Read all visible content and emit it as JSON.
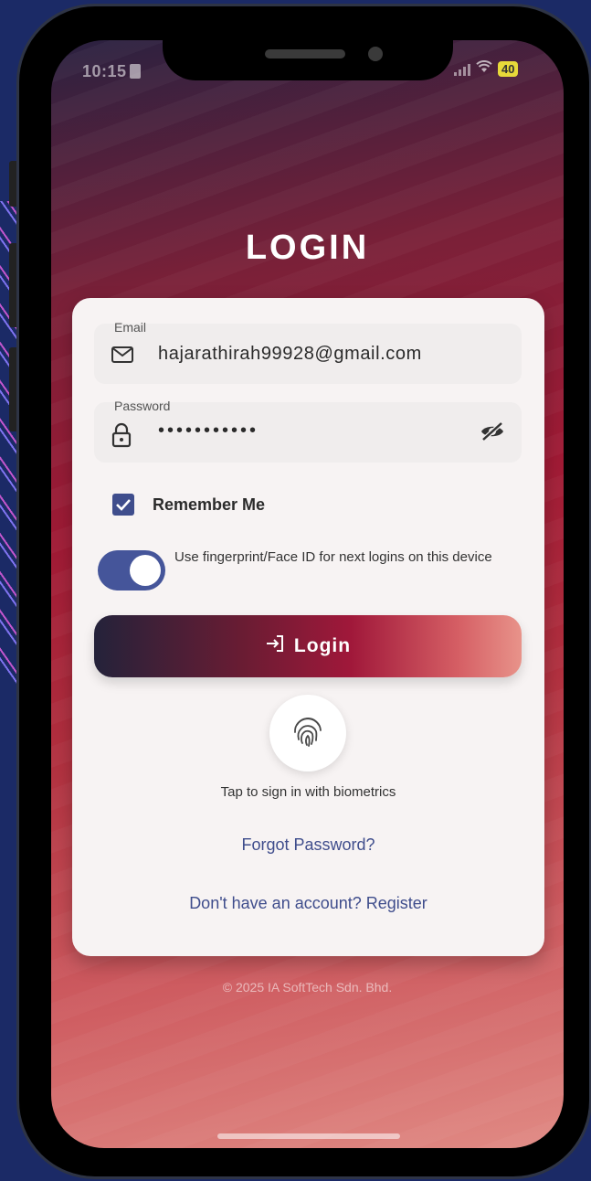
{
  "status_bar": {
    "time": "10:15",
    "battery": "40"
  },
  "page": {
    "title": "LOGIN"
  },
  "form": {
    "email_label": "Email",
    "email_value": "hajarathirah99928@gmail.com",
    "password_label": "Password",
    "password_value": "•••••••••••",
    "remember_me_label": "Remember Me",
    "remember_me_checked": true,
    "biometric_toggle_label": "Use fingerprint/Face ID for next logins on this device",
    "biometric_toggle_on": true,
    "login_button_label": "Login",
    "biometric_prompt": "Tap to sign in with biometrics",
    "forgot_password_link": "Forgot Password?",
    "register_link": "Don't have an account? Register"
  },
  "footer": {
    "copyright": "© 2025 IA SoftTech Sdn. Bhd."
  },
  "icons": {
    "email": "mail-icon",
    "password": "lock-icon",
    "visibility": "eye-off-icon",
    "login": "login-arrow-icon",
    "biometric": "fingerprint-icon"
  },
  "colors": {
    "accent": "#3f4d8c",
    "card_bg": "#f7f3f3",
    "gradient_dark": "#24223a",
    "gradient_red": "#a0183a",
    "gradient_light": "#e8938a"
  }
}
